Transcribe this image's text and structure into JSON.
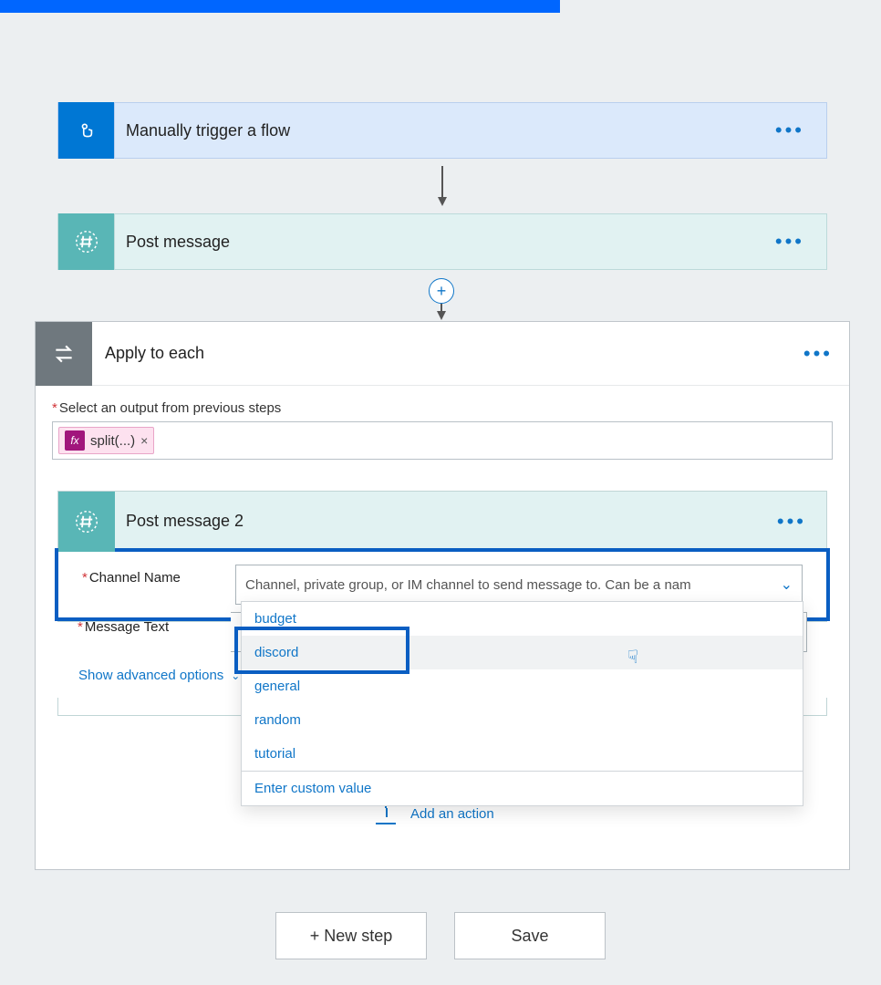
{
  "header_bar": true,
  "trigger": {
    "title": "Manually trigger a flow"
  },
  "post1_title": "Post message",
  "apply": {
    "title": "Apply to each",
    "select_label": "Select an output from previous steps",
    "chip": {
      "fx": "fx",
      "text": "split(...)",
      "close": "×"
    }
  },
  "post2": {
    "title": "Post message 2",
    "channel_label": "Channel Name",
    "channel_placeholder": "Channel, private group, or IM channel to send message to. Can be a nam",
    "message_label": "Message Text",
    "advanced": "Show advanced options",
    "dropdown": {
      "options": [
        "budget",
        "discord",
        "general",
        "random",
        "tutorial"
      ],
      "custom": "Enter custom value",
      "hovered_index": 1
    }
  },
  "add_action": "Add an action",
  "buttons": {
    "new_step": "+ New step",
    "save": "Save"
  }
}
